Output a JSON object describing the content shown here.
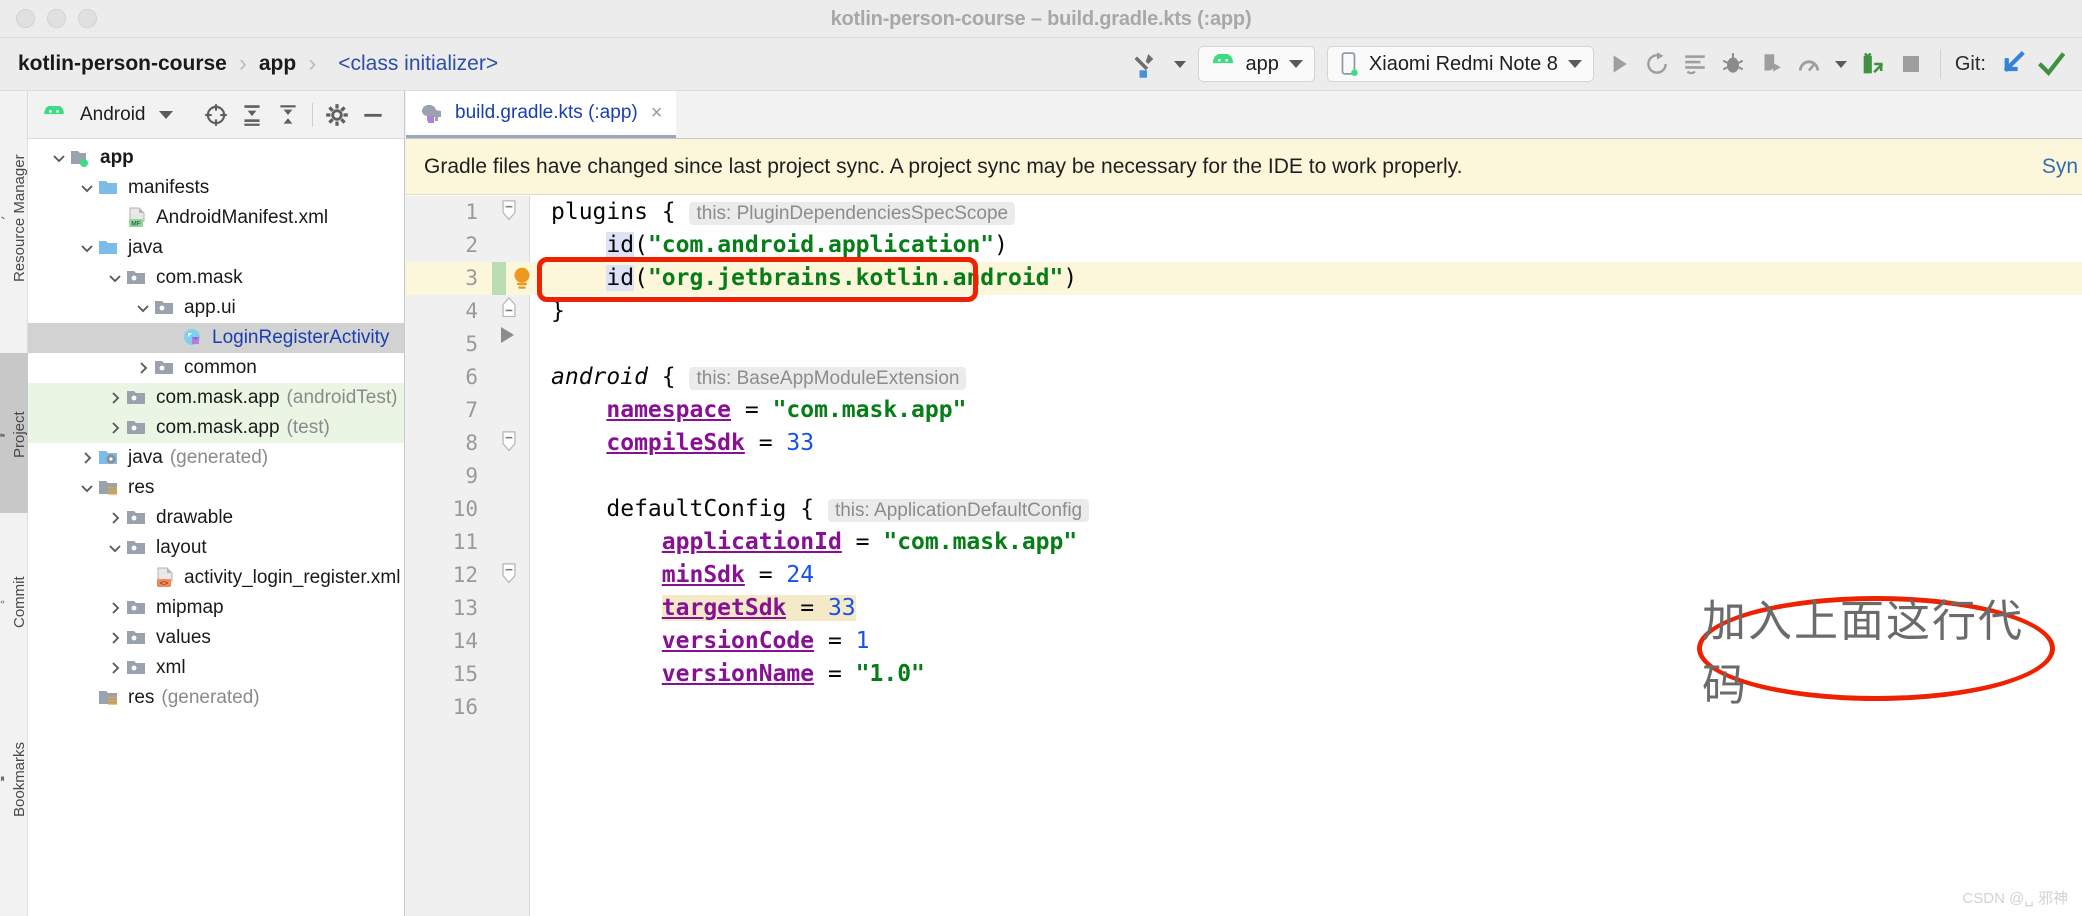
{
  "window": {
    "title": "kotlin-person-course – build.gradle.kts (:app)",
    "traffic_lights": [
      "close",
      "minimize",
      "zoom"
    ]
  },
  "breadcrumb": {
    "items": [
      {
        "label": "kotlin-person-course",
        "kind": "project"
      },
      {
        "label": "app",
        "kind": "module"
      },
      {
        "label": "<class initializer>",
        "kind": "link"
      }
    ],
    "separator": "›"
  },
  "toolbar": {
    "build_icon": "hammer-icon",
    "build_caret": "chevron-down-icon",
    "run_config": {
      "label": "app",
      "icon": "android-robot-icon",
      "caret": "chevron-down-icon"
    },
    "device": {
      "label": "Xiaomi Redmi Note 8",
      "icon": "phone-icon",
      "caret": "chevron-down-icon"
    },
    "actions": [
      {
        "name": "run-button",
        "icon": "play-icon"
      },
      {
        "name": "apply-changes-button",
        "icon": "rerun-arrow-icon"
      },
      {
        "name": "apply-code-changes-button",
        "icon": "lines-arrow-icon"
      },
      {
        "name": "debug-button",
        "icon": "bug-icon"
      },
      {
        "name": "attach-debugger-button",
        "icon": "attach-debug-icon"
      },
      {
        "name": "profile-button",
        "icon": "profiler-icon"
      },
      {
        "name": "profile-dropdown",
        "icon": "chevron-down-icon"
      },
      {
        "name": "device-manager-button",
        "icon": "deploy-icon"
      },
      {
        "name": "stop-button",
        "icon": "stop-square-icon"
      }
    ],
    "git": {
      "label": "Git:",
      "actions": [
        {
          "name": "update-project-button",
          "icon": "pull-arrow-icon"
        },
        {
          "name": "commit-button",
          "icon": "checkmark-icon"
        }
      ]
    }
  },
  "left_strip": {
    "tabs": [
      {
        "label": "Resource Manager",
        "icon": "resource-manager-icon",
        "active": false
      },
      {
        "label": "Project",
        "icon": "project-folder-icon",
        "active": true
      },
      {
        "label": "Commit",
        "icon": "commit-icon",
        "active": false
      },
      {
        "label": "Bookmarks",
        "icon": "bookmark-icon",
        "active": false
      }
    ]
  },
  "project_panel": {
    "title": "Android",
    "title_icon": "android-robot-icon",
    "title_caret": "chevron-down-icon",
    "header_actions": [
      {
        "name": "select-opened-file-button",
        "icon": "crosshair-target-icon"
      },
      {
        "name": "expand-all-button",
        "icon": "expand-all-icon"
      },
      {
        "name": "collapse-all-button",
        "icon": "collapse-all-icon"
      },
      {
        "name": "panel-settings-button",
        "icon": "gear-icon"
      },
      {
        "name": "hide-panel-button",
        "icon": "minus-icon"
      }
    ],
    "tree": [
      {
        "label": "app",
        "suffix": "",
        "depth": 0,
        "twisty": "expanded",
        "icon": "module-folder-icon",
        "bold": true,
        "state": "normal"
      },
      {
        "label": "manifests",
        "suffix": "",
        "depth": 1,
        "twisty": "expanded",
        "icon": "blue-folder-icon",
        "bold": false,
        "state": "normal"
      },
      {
        "label": "AndroidManifest.xml",
        "suffix": "",
        "depth": 2,
        "twisty": "none",
        "icon": "manifest-file-icon",
        "bold": false,
        "state": "normal"
      },
      {
        "label": "java",
        "suffix": "",
        "depth": 1,
        "twisty": "expanded",
        "icon": "blue-folder-icon",
        "bold": false,
        "state": "normal"
      },
      {
        "label": "com.mask",
        "suffix": "",
        "depth": 2,
        "twisty": "expanded",
        "icon": "package-folder-icon",
        "bold": false,
        "state": "normal"
      },
      {
        "label": "app.ui",
        "suffix": "",
        "depth": 3,
        "twisty": "expanded",
        "icon": "package-folder-icon",
        "bold": false,
        "state": "normal"
      },
      {
        "label": "LoginRegisterActivity",
        "suffix": "",
        "depth": 4,
        "twisty": "none",
        "icon": "kotlin-class-icon",
        "bold": false,
        "state": "selected"
      },
      {
        "label": "common",
        "suffix": "",
        "depth": 3,
        "twisty": "collapsed",
        "icon": "package-folder-icon",
        "bold": false,
        "state": "normal"
      },
      {
        "label": "com.mask.app",
        "suffix": "(androidTest)",
        "depth": 2,
        "twisty": "collapsed",
        "icon": "package-folder-icon",
        "bold": false,
        "state": "testsource"
      },
      {
        "label": "com.mask.app",
        "suffix": "(test)",
        "depth": 2,
        "twisty": "collapsed",
        "icon": "package-folder-icon",
        "bold": false,
        "state": "testsource"
      },
      {
        "label": "java",
        "suffix": "(generated)",
        "depth": 1,
        "twisty": "collapsed",
        "icon": "generated-folder-icon",
        "bold": false,
        "state": "normal"
      },
      {
        "label": "res",
        "suffix": "",
        "depth": 1,
        "twisty": "expanded",
        "icon": "res-folder-icon",
        "bold": false,
        "state": "normal"
      },
      {
        "label": "drawable",
        "suffix": "",
        "depth": 2,
        "twisty": "collapsed",
        "icon": "package-folder-icon",
        "bold": false,
        "state": "normal"
      },
      {
        "label": "layout",
        "suffix": "",
        "depth": 2,
        "twisty": "expanded",
        "icon": "package-folder-icon",
        "bold": false,
        "state": "normal"
      },
      {
        "label": "activity_login_register.xml",
        "suffix": "",
        "depth": 3,
        "twisty": "none",
        "icon": "xml-layout-file-icon",
        "bold": false,
        "state": "normal"
      },
      {
        "label": "mipmap",
        "suffix": "",
        "depth": 2,
        "twisty": "collapsed",
        "icon": "package-folder-icon",
        "bold": false,
        "state": "normal"
      },
      {
        "label": "values",
        "suffix": "",
        "depth": 2,
        "twisty": "collapsed",
        "icon": "package-folder-icon",
        "bold": false,
        "state": "normal"
      },
      {
        "label": "xml",
        "suffix": "",
        "depth": 2,
        "twisty": "collapsed",
        "icon": "package-folder-icon",
        "bold": false,
        "state": "normal"
      },
      {
        "label": "res",
        "suffix": "(generated)",
        "depth": 1,
        "twisty": "none",
        "icon": "res-folder-icon",
        "bold": false,
        "state": "normal"
      }
    ]
  },
  "editor": {
    "tab": {
      "label": "build.gradle.kts (:app)",
      "icon": "gradle-elephant-icon",
      "close": "×"
    },
    "notification": {
      "message": "Gradle files have changed since last project sync. A project sync may be necessary for the IDE to work properly.",
      "action_label": "Syn"
    },
    "line_numbers": [
      "1",
      "2",
      "3",
      "4",
      "5",
      "6",
      "7",
      "8",
      "9",
      "10",
      "11",
      "12",
      "13",
      "14",
      "15",
      "16"
    ],
    "code_lines": [
      {
        "n": 1,
        "tokens": [
          {
            "t": "plain",
            "v": "plugins { "
          },
          {
            "t": "hint",
            "v": "this: PluginDependenciesSpecScope"
          }
        ]
      },
      {
        "n": 2,
        "tokens": [
          {
            "t": "plain",
            "v": "    "
          },
          {
            "t": "idsel",
            "v": "id"
          },
          {
            "t": "plain",
            "v": "("
          },
          {
            "t": "str",
            "v": "\"com.android.application\""
          },
          {
            "t": "plain",
            "v": ")"
          }
        ]
      },
      {
        "n": 3,
        "tokens": [
          {
            "t": "plain",
            "v": "    "
          },
          {
            "t": "idsel",
            "v": "id"
          },
          {
            "t": "plain",
            "v": "("
          },
          {
            "t": "str",
            "v": "\"org.jetbrains.kotlin.android\""
          },
          {
            "t": "plain",
            "v": ")"
          }
        ]
      },
      {
        "n": 4,
        "tokens": [
          {
            "t": "plain",
            "v": "}"
          }
        ]
      },
      {
        "n": 5,
        "tokens": []
      },
      {
        "n": 6,
        "tokens": [
          {
            "t": "kw",
            "v": "android"
          },
          {
            "t": "plain",
            "v": " { "
          },
          {
            "t": "hint",
            "v": "this: BaseAppModuleExtension"
          }
        ]
      },
      {
        "n": 7,
        "tokens": [
          {
            "t": "plain",
            "v": "    "
          },
          {
            "t": "prop",
            "v": "namespace"
          },
          {
            "t": "plain",
            "v": " = "
          },
          {
            "t": "str",
            "v": "\"com.mask.app\""
          }
        ]
      },
      {
        "n": 8,
        "tokens": [
          {
            "t": "plain",
            "v": "    "
          },
          {
            "t": "prop",
            "v": "compileSdk"
          },
          {
            "t": "plain",
            "v": " = "
          },
          {
            "t": "num",
            "v": "33"
          }
        ]
      },
      {
        "n": 9,
        "tokens": []
      },
      {
        "n": 10,
        "tokens": [
          {
            "t": "plain",
            "v": "    defaultConfig { "
          },
          {
            "t": "hint",
            "v": "this: ApplicationDefaultConfig"
          }
        ]
      },
      {
        "n": 11,
        "tokens": [
          {
            "t": "plain",
            "v": "        "
          },
          {
            "t": "prop",
            "v": "applicationId"
          },
          {
            "t": "plain",
            "v": " = "
          },
          {
            "t": "str",
            "v": "\"com.mask.app\""
          }
        ]
      },
      {
        "n": 12,
        "tokens": [
          {
            "t": "plain",
            "v": "        "
          },
          {
            "t": "prop",
            "v": "minSdk"
          },
          {
            "t": "plain",
            "v": " = "
          },
          {
            "t": "num",
            "v": "24"
          }
        ]
      },
      {
        "n": 13,
        "tokens": [
          {
            "t": "plain",
            "v": "        "
          },
          {
            "t": "prop-hl",
            "v": "targetSdk"
          },
          {
            "t": "plain-hl",
            "v": " = "
          },
          {
            "t": "num-hl",
            "v": "33"
          }
        ]
      },
      {
        "n": 14,
        "tokens": [
          {
            "t": "plain",
            "v": "        "
          },
          {
            "t": "prop",
            "v": "versionCode"
          },
          {
            "t": "plain",
            "v": " = "
          },
          {
            "t": "num",
            "v": "1"
          }
        ]
      },
      {
        "n": 15,
        "tokens": [
          {
            "t": "plain",
            "v": "        "
          },
          {
            "t": "prop",
            "v": "versionName"
          },
          {
            "t": "plain",
            "v": " = "
          },
          {
            "t": "str",
            "v": "\"1.0\""
          }
        ]
      },
      {
        "n": 16,
        "tokens": []
      }
    ],
    "gutter_icons": [
      {
        "name": "intention-bulb-icon",
        "line": 3
      },
      {
        "name": "run-gutter-icon",
        "line": 4
      }
    ]
  },
  "annotations": {
    "highlight_box": {
      "name": "red-highlight-box",
      "target_line": 3
    },
    "callout": {
      "name": "red-callout-ellipse",
      "text": "加入上面这行代码"
    },
    "accent_color": "#ee2200"
  },
  "watermark": {
    "text": "CSDN @␣ 邪神"
  }
}
